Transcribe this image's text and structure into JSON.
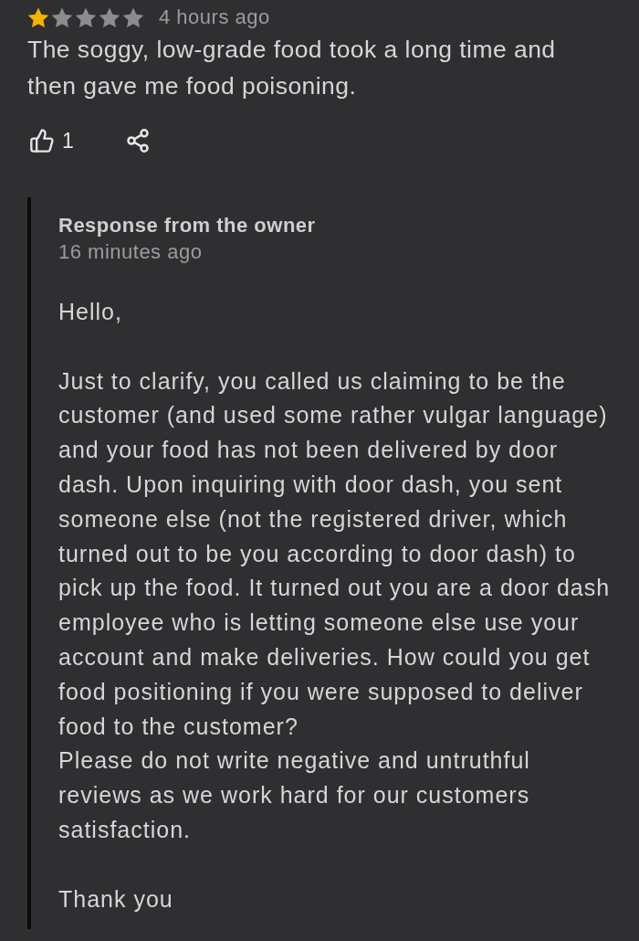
{
  "review": {
    "stars": 1,
    "time": "4 hours ago",
    "text": "The soggy, low-grade food took a long time and then gave me food poisoning.",
    "likes": "1"
  },
  "owner_response": {
    "title": "Response from the owner",
    "time": "16 minutes ago",
    "paragraphs": [
      "Hello,",
      "Just to clarify, you called us claiming to be the customer (and used some rather vulgar language) and your food has not been delivered by door dash. Upon inquiring with door dash, you sent someone else (not the registered driver, which turned out to be you according to door dash) to pick up the food. It turned out you are a door dash employee who is letting someone else use your account and make deliveries. How could you get food positioning if you were supposed to deliver food to the customer?\nPlease do not write negative and untruthful reviews as we work hard for our customers satisfaction.",
      "Thank you"
    ]
  }
}
